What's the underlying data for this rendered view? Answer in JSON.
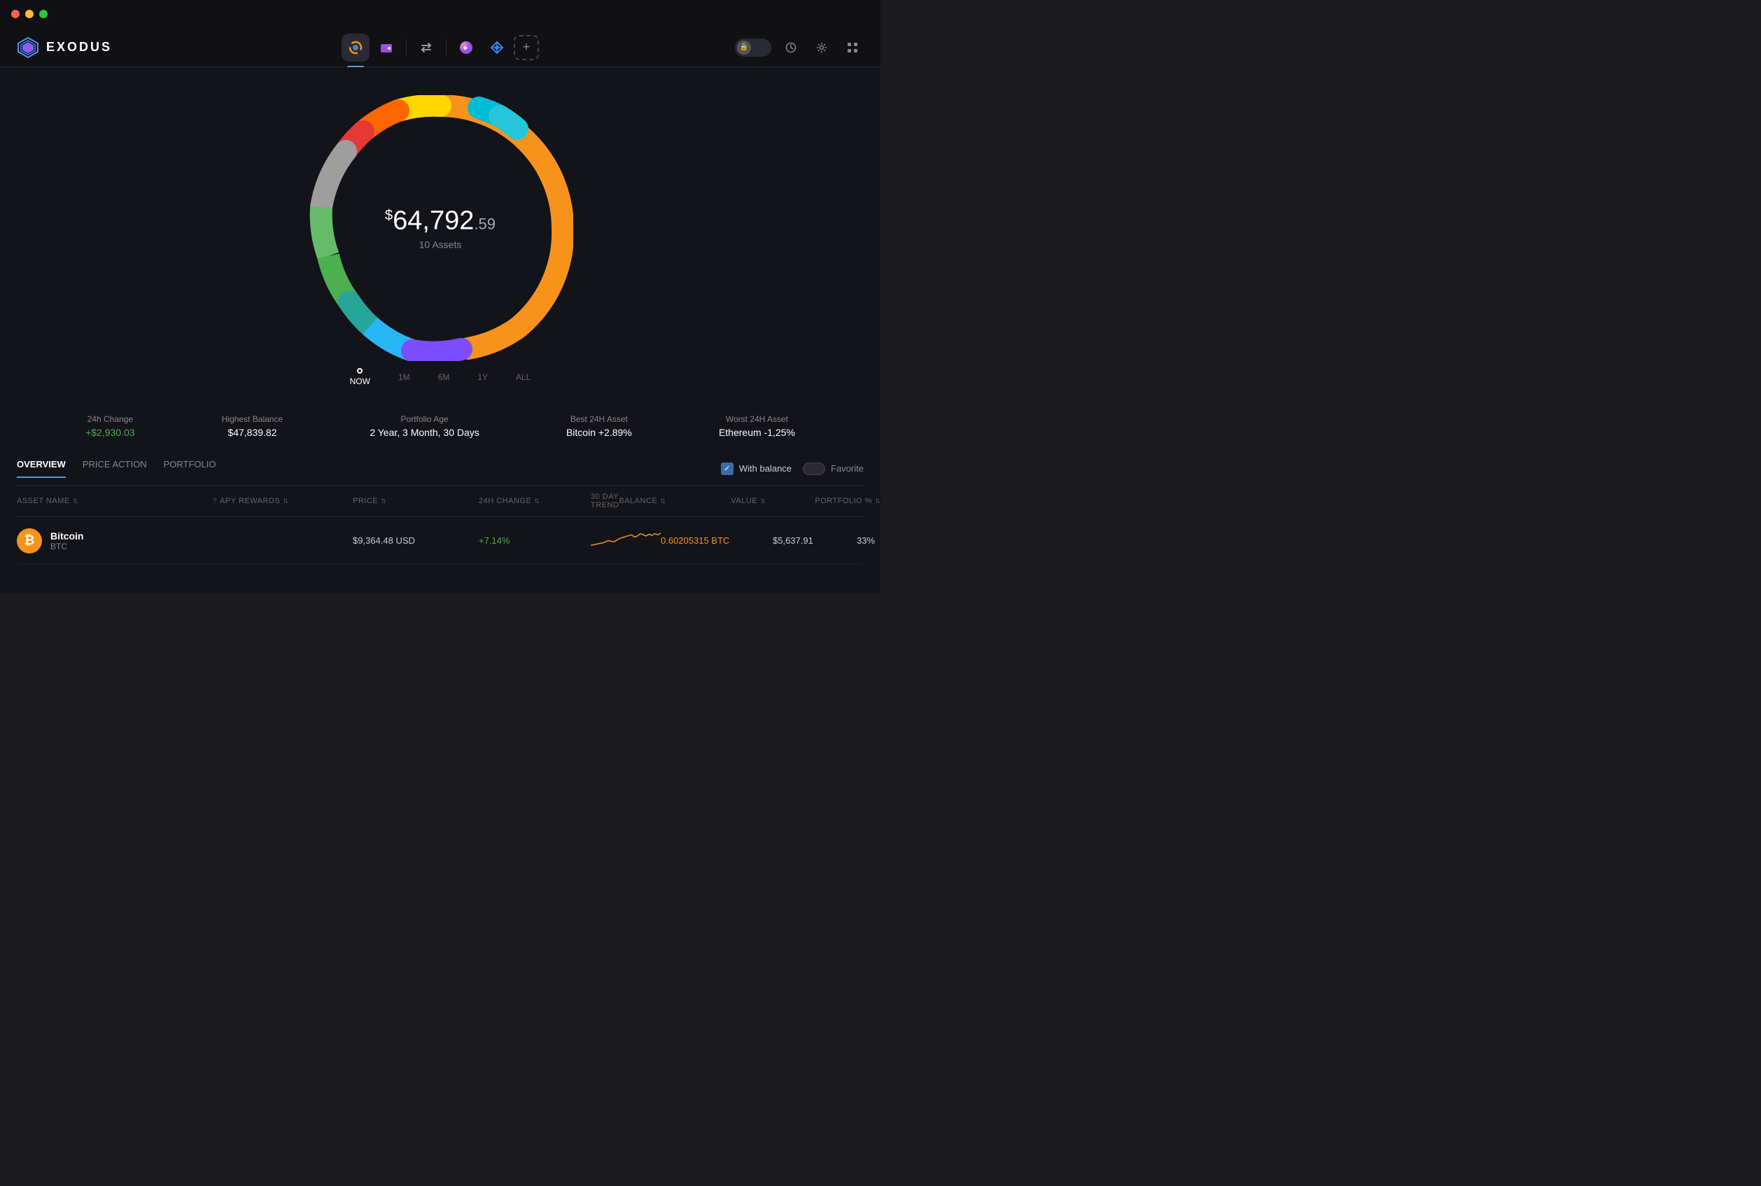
{
  "titlebar": {
    "dots": [
      "red",
      "yellow",
      "green"
    ]
  },
  "header": {
    "logo_text": "EXODUS",
    "nav_items": [
      {
        "id": "portfolio",
        "active": true
      },
      {
        "id": "wallet",
        "active": false
      },
      {
        "id": "exchange",
        "active": false
      },
      {
        "id": "nft",
        "active": false
      },
      {
        "id": "web3",
        "active": false
      }
    ],
    "right_actions": [
      "lock",
      "history",
      "settings",
      "apps"
    ]
  },
  "donut": {
    "amount_prefix": "$",
    "amount_whole": "64,792",
    "amount_cents": ".59",
    "assets_label": "10 Assets",
    "segments": [
      {
        "color": "#f7931a",
        "pct": 42
      },
      {
        "color": "#ffd700",
        "pct": 12
      },
      {
        "color": "#ff6600",
        "pct": 5
      },
      {
        "color": "#ff3333",
        "pct": 4
      },
      {
        "color": "#00bcd4",
        "pct": 3
      },
      {
        "color": "#26c6da",
        "pct": 3
      },
      {
        "color": "#4caf50",
        "pct": 8
      },
      {
        "color": "#8bc34a",
        "pct": 6
      },
      {
        "color": "#66bb6a",
        "pct": 4
      },
      {
        "color": "#29b6f6",
        "pct": 7
      },
      {
        "color": "#7c4dff",
        "pct": 4
      },
      {
        "color": "#cccccc",
        "pct": 2
      }
    ]
  },
  "timeline": {
    "items": [
      {
        "label": "NOW",
        "active": true
      },
      {
        "label": "1M",
        "active": false
      },
      {
        "label": "6M",
        "active": false
      },
      {
        "label": "1Y",
        "active": false
      },
      {
        "label": "ALL",
        "active": false
      }
    ]
  },
  "stats": [
    {
      "label": "24h Change",
      "value": "+$2,930.03",
      "positive": true
    },
    {
      "label": "Highest Balance",
      "value": "$47,839.82",
      "positive": false
    },
    {
      "label": "Portfolio Age",
      "value": "2 Year, 3 Month, 30 Days",
      "positive": false
    },
    {
      "label": "Best 24H Asset",
      "value": "Bitcoin +2.89%",
      "positive": false
    },
    {
      "label": "Worst 24H Asset",
      "value": "Ethereum -1,25%",
      "positive": false
    }
  ],
  "table": {
    "tabs": [
      {
        "label": "OVERVIEW",
        "active": true
      },
      {
        "label": "PRICE ACTION",
        "active": false
      },
      {
        "label": "PORTFOLIO",
        "active": false
      }
    ],
    "with_balance_label": "With balance",
    "favorite_label": "Favorite",
    "columns": [
      {
        "label": "ASSET NAME",
        "sortable": true
      },
      {
        "label": "APY REWARDS",
        "sortable": true,
        "has_help": true
      },
      {
        "label": "PRICE",
        "sortable": true
      },
      {
        "label": "24H CHANGE",
        "sortable": true
      },
      {
        "label": "30 DAY TREND",
        "sortable": false
      },
      {
        "label": "BALANCE",
        "sortable": true
      },
      {
        "label": "VALUE",
        "sortable": true
      },
      {
        "label": "PORTFOLIO %",
        "sortable": true
      }
    ],
    "rows": [
      {
        "name": "Bitcoin",
        "symbol": "BTC",
        "icon_bg": "#f7931a",
        "icon_text": "₿",
        "apy": "",
        "price": "$9,364.48 USD",
        "change_24h": "+7.14%",
        "change_positive": true,
        "balance": "0.60205315 BTC",
        "balance_highlight": true,
        "value": "$5,637.91",
        "portfolio_pct": "33%"
      }
    ]
  }
}
